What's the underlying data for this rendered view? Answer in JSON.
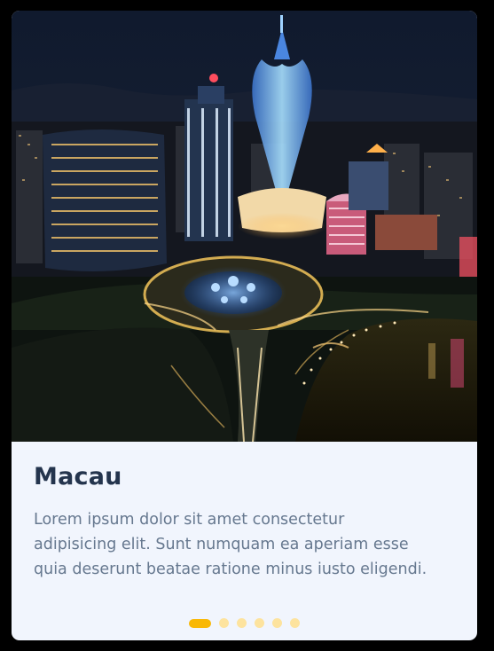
{
  "card": {
    "image_alt": "Aerial night view of Macau city skyline",
    "title": "Macau",
    "description_lines": [
      "Lorem ipsum dolor sit amet consectetur",
      "adipisicing elit. Sunt numquam ea aperiam esse",
      "quia deserunt beatae ratione minus iusto eligendi."
    ]
  },
  "pagination": {
    "total": 6,
    "active_index": 0
  },
  "colors": {
    "card_background": "#f1f5fd",
    "title": "#24344d",
    "body_text": "#66788f",
    "dot_active": "#f9b806",
    "dot_inactive": "#fde39e"
  }
}
